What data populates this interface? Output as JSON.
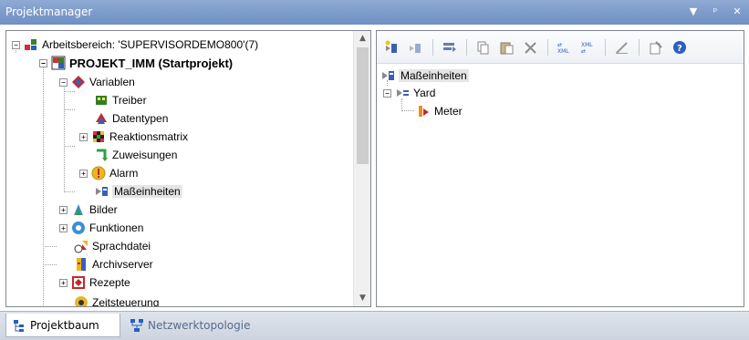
{
  "window": {
    "title": "Projektmanager",
    "buttons": [
      "dropdown",
      "pin",
      "close"
    ]
  },
  "tree": {
    "items": [
      {
        "label": "Arbeitsbereich: 'SUPERVISORDEMO800'(7)",
        "icon": "workspace-icon",
        "expander": "-"
      },
      {
        "label": "PROJEKT_IMM (Startprojekt)",
        "icon": "project-icon",
        "expander": "-"
      },
      {
        "label": "Variablen",
        "icon": "variables-icon",
        "expander": "-"
      },
      {
        "label": "Treiber",
        "icon": "driver-icon",
        "expander": ""
      },
      {
        "label": "Datentypen",
        "icon": "datatypes-icon",
        "expander": ""
      },
      {
        "label": "Reaktionsmatrix",
        "icon": "reaction-matrix-icon",
        "expander": "+"
      },
      {
        "label": "Zuweisungen",
        "icon": "assignments-icon",
        "expander": ""
      },
      {
        "label": "Alarm",
        "icon": "alarm-icon",
        "expander": "+"
      },
      {
        "label": "Maßeinheiten",
        "icon": "units-icon",
        "expander": "",
        "selected": true
      },
      {
        "label": "Bilder",
        "icon": "screens-icon",
        "expander": "+"
      },
      {
        "label": "Funktionen",
        "icon": "functions-icon",
        "expander": "+"
      },
      {
        "label": "Sprachdatei",
        "icon": "language-icon",
        "expander": ""
      },
      {
        "label": "Archivserver",
        "icon": "archive-icon",
        "expander": ""
      },
      {
        "label": "Rezepte",
        "icon": "recipes-icon",
        "expander": "+"
      },
      {
        "label": "Zeitsteuerung",
        "icon": "scheduler-icon",
        "expander": ""
      }
    ]
  },
  "toolbar": {
    "buttons": [
      "new-unit-icon",
      "new-conversion-icon",
      "rename-icon",
      "copy-icon",
      "paste-icon",
      "delete-icon",
      "export-xml-icon",
      "import-xml-icon",
      "edit-icon",
      "properties-icon",
      "help-icon"
    ]
  },
  "units_tree": {
    "root": "Maßeinheiten",
    "child": "Yard",
    "grandchild": "Meter"
  },
  "tabs": [
    {
      "label": "Projektbaum",
      "active": true
    },
    {
      "label": "Netzwerktopologie",
      "active": false
    }
  ]
}
